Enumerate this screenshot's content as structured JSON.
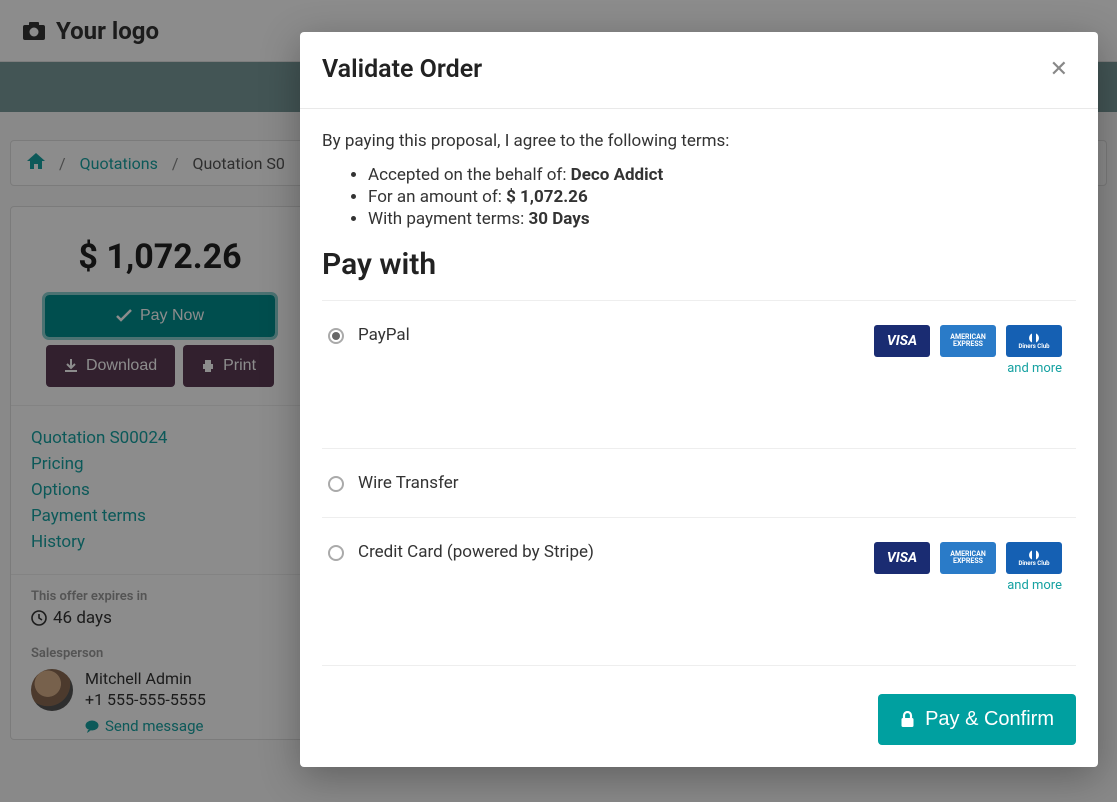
{
  "brand": {
    "logo_text": "Your logo"
  },
  "breadcrumb": {
    "home_label": "Home",
    "quotations_label": "Quotations",
    "current": "Quotation S0"
  },
  "sidebar": {
    "amount": "$ 1,072.26",
    "pay_now": "Pay Now",
    "download": "Download",
    "print": "Print",
    "links": {
      "quotation": "Quotation S00024",
      "pricing": "Pricing",
      "options": "Options",
      "payment_terms": "Payment terms",
      "history": "History"
    },
    "expires_label": "This offer expires in",
    "expires_value": "46 days",
    "salesperson_label": "Salesperson",
    "salesperson_name": "Mitchell Admin",
    "salesperson_phone": "+1 555-555-5555",
    "send_message": "Send message"
  },
  "modal": {
    "title": "Validate Order",
    "agree_text": "By paying this proposal, I agree to the following terms:",
    "terms": {
      "behalf_prefix": "Accepted on the behalf of: ",
      "behalf_name": "Deco Addict",
      "amount_prefix": "For an amount of: ",
      "amount_value": "$ 1,072.26",
      "terms_prefix": "With payment terms: ",
      "terms_value": "30 Days"
    },
    "pay_with_title": "Pay with",
    "and_more": "and more",
    "options": {
      "paypal": "PayPal",
      "wire": "Wire Transfer",
      "stripe": "Credit Card (powered by Stripe)"
    },
    "cards": {
      "visa": "VISA",
      "amex": "AMERICAN EXPRESS",
      "diners": "Diners Club"
    },
    "confirm_button": "Pay & Confirm"
  }
}
